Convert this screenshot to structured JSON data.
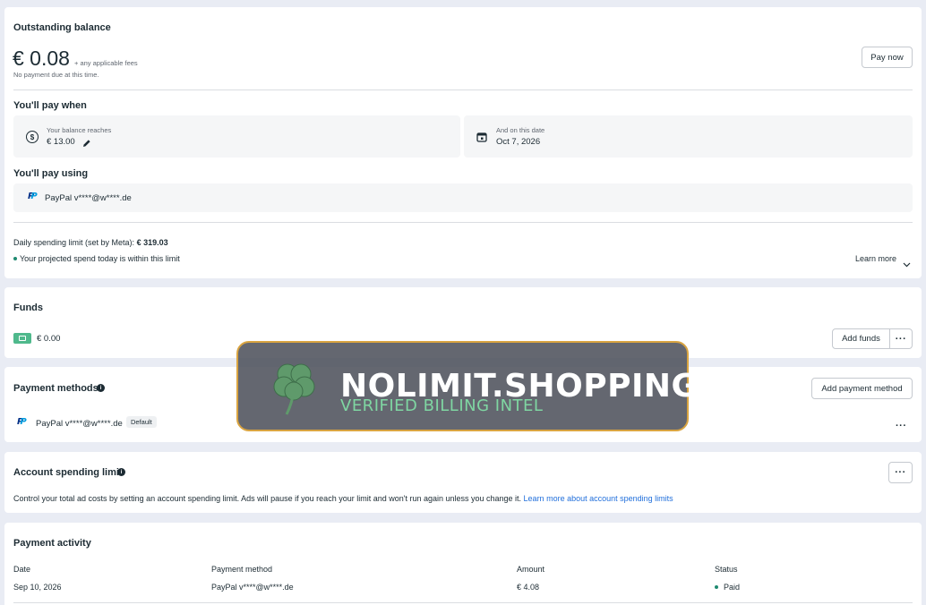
{
  "balance": {
    "title": "Outstanding balance",
    "amount": "€ 0.08",
    "fees_note": "+ any applicable fees",
    "due_note": "No payment due at this time.",
    "pay_now_label": "Pay now"
  },
  "pay_when": {
    "title": "You'll pay when",
    "threshold_label": "Your balance reaches",
    "threshold_value": "€ 13.00",
    "date_label": "And on this date",
    "date_value": "Oct 7, 2026"
  },
  "pay_using": {
    "title": "You'll pay using",
    "method": "PayPal v****@w****.de"
  },
  "daily_limit": {
    "label": "Daily spending limit (set by Meta): ",
    "value": "€ 319.03",
    "status": "Your projected spend today is within this limit",
    "learn_more": "Learn more"
  },
  "funds": {
    "title": "Funds",
    "amount": "€ 0.00",
    "add_label": "Add funds"
  },
  "payment_methods": {
    "title": "Payment methods",
    "add_label": "Add payment method",
    "method": "PayPal v****@w****.de",
    "badge": "Default"
  },
  "spending_limit": {
    "title": "Account spending limit",
    "description": "Control your total ad costs by setting an account spending limit. Ads will pause if you reach your limit and won't run again unless you change it.",
    "link": "Learn more about account spending limits"
  },
  "activity": {
    "title": "Payment activity",
    "columns": [
      "Date",
      "Payment method",
      "Amount",
      "Status"
    ],
    "rows": [
      [
        "Sep 10, 2026",
        "PayPal v****@w****.de",
        "€ 4.08",
        "Paid"
      ]
    ]
  },
  "overlay": {
    "title": "NOLIMIT.SHOPPING",
    "subtitle": "VERIFIED BILLING INTEL"
  },
  "colors": {
    "accent_link": "#216fdb",
    "status_dot": "#1f8a70",
    "funds_icon": "#4fb98c",
    "overlay_border": "#d9a441"
  },
  "icons": {
    "edit": "pencil-icon",
    "calendar": "calendar-icon",
    "coin": "coin-icon",
    "info": "info-icon",
    "chevron": "chevron-down-icon",
    "more": "more-icon",
    "clover": "clover-icon"
  }
}
